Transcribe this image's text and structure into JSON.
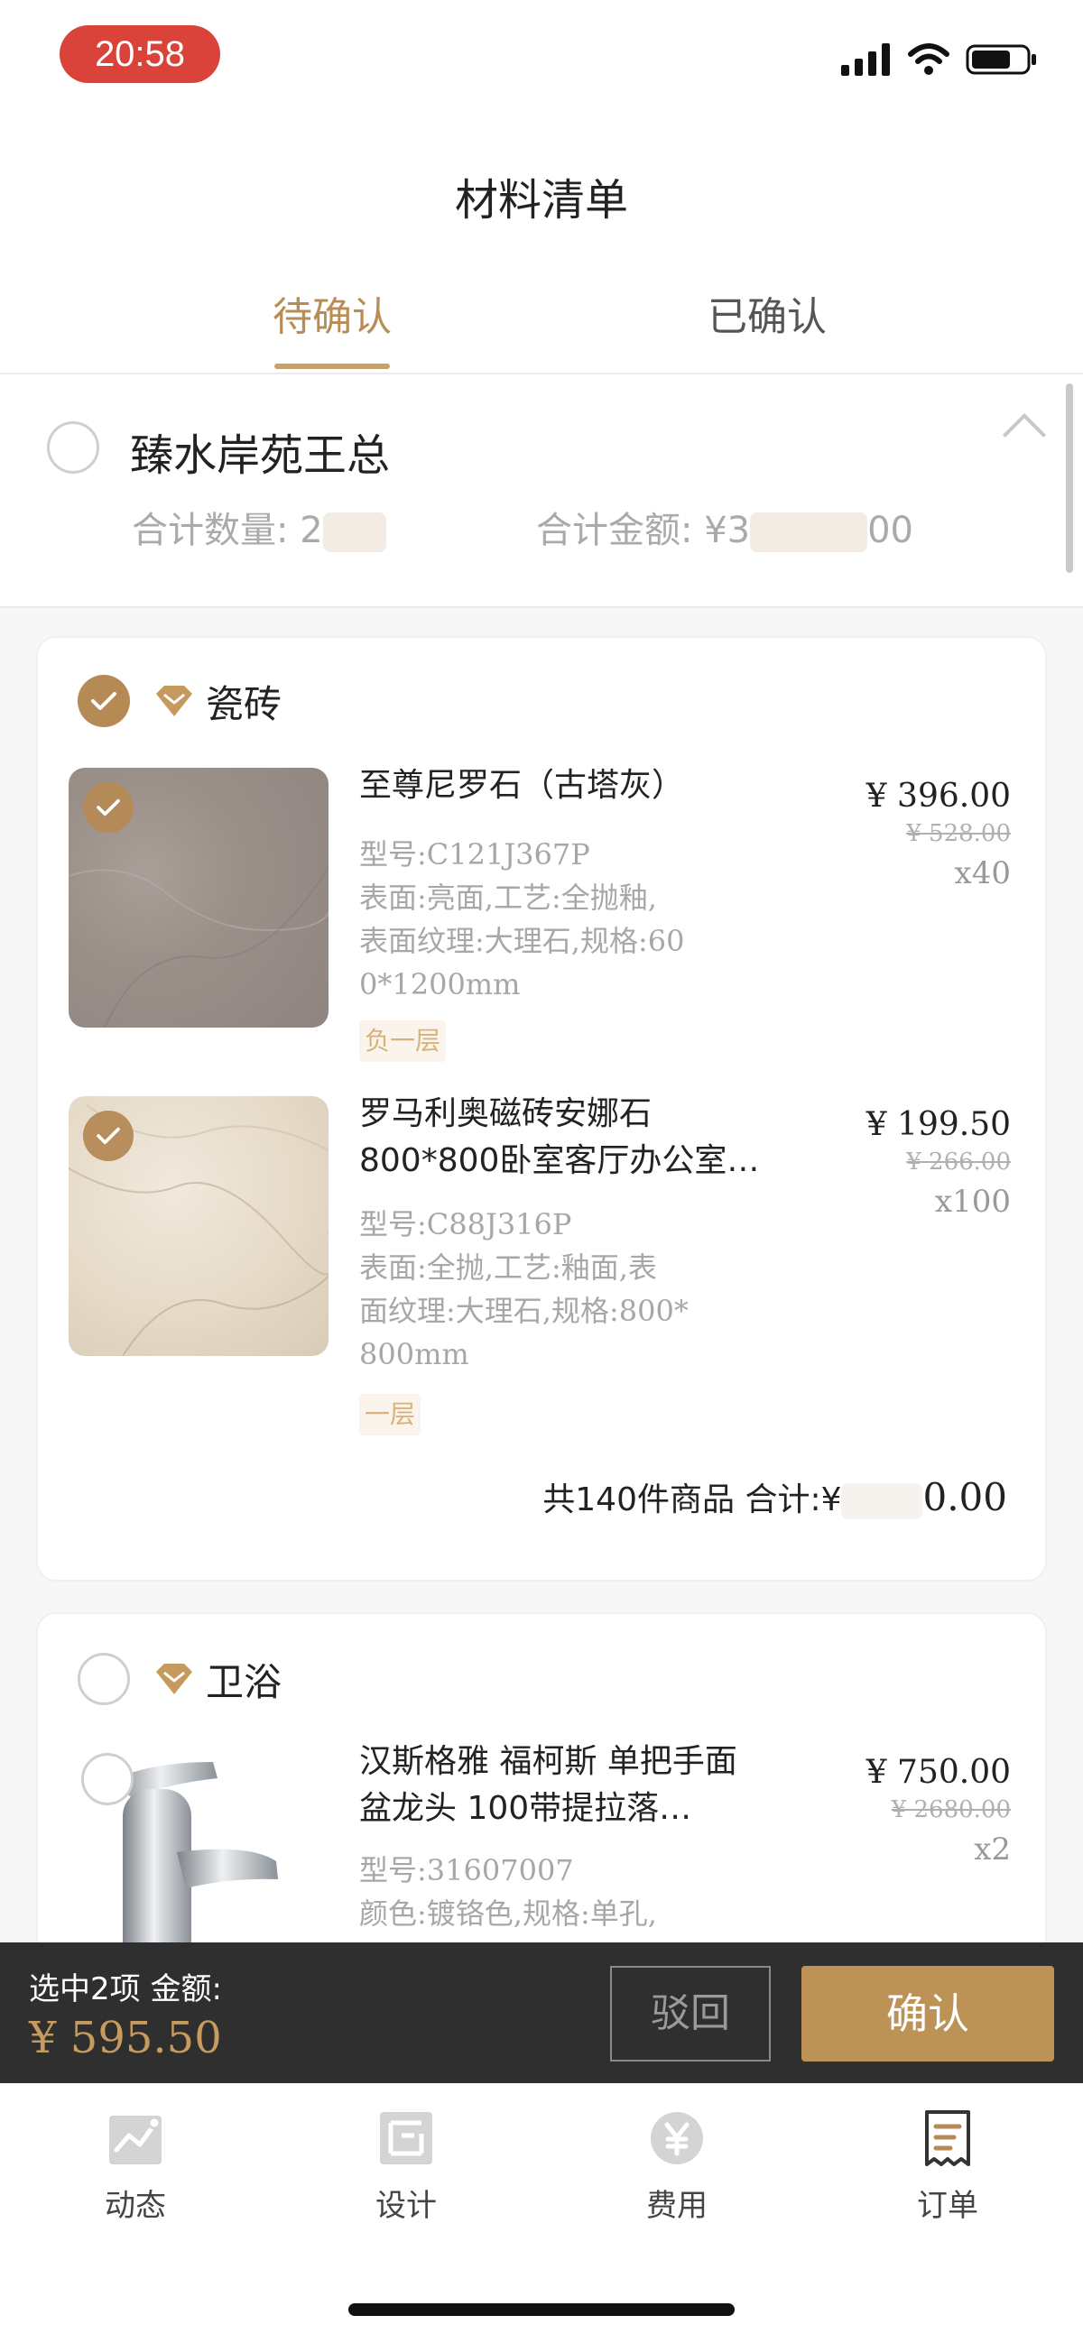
{
  "status_bar": {
    "time": "20:58"
  },
  "header": {
    "title": "材料清单"
  },
  "tabs": [
    {
      "label": "待确认",
      "active": true
    },
    {
      "label": "已确认",
      "active": false
    }
  ],
  "group": {
    "name": "臻水岸苑王总",
    "qty_label": "合计数量: 2",
    "amount_label": "合计金额: ¥3",
    "amount_tail": "00"
  },
  "cards": [
    {
      "category": "瓷砖",
      "checked": true,
      "items": [
        {
          "title": "至尊尼罗石（古塔灰）",
          "spec": [
            "型号:C121J367P",
            "表面:亮面,工艺:全抛釉,",
            "表面纹理:大理石,规格:60",
            "0*1200mm"
          ],
          "floor": "负一层",
          "price": "¥ 396.00",
          "old_price": "¥ 528.00",
          "qty": "x40",
          "checked": true
        },
        {
          "title": "罗马利奥磁砖安娜石800*800卧室客厅办公室…",
          "spec": [
            "型号:C88J316P",
            "表面:全抛,工艺:釉面,表",
            "面纹理:大理石,规格:800*",
            "800mm"
          ],
          "floor": "一层",
          "price": "¥ 199.50",
          "old_price": "¥ 266.00",
          "qty": "x100",
          "checked": true
        }
      ],
      "total_label": "共140件商品 合计:¥",
      "total_tail": "0.00"
    },
    {
      "category": "卫浴",
      "checked": false,
      "items": [
        {
          "title": "汉斯格雅 福柯斯 单把手面盆龙头 100带提拉落…",
          "spec": [
            "型号:31607007",
            "颜色:镀铬色,规格:单孔,"
          ],
          "price": "¥ 750.00",
          "old_price": "¥ 2680.00",
          "qty": "x2",
          "checked": false
        }
      ]
    }
  ],
  "action_bar": {
    "selected_label": "选中2项 金额:",
    "selected_amount": "¥ 595.50",
    "reject_label": "驳回",
    "confirm_label": "确认"
  },
  "tabbar": [
    {
      "label": "动态",
      "icon": "chart-icon"
    },
    {
      "label": "设计",
      "icon": "design-icon"
    },
    {
      "label": "费用",
      "icon": "yuan-coin-icon"
    },
    {
      "label": "订单",
      "icon": "receipt-icon"
    }
  ],
  "colors": {
    "accent": "#bd9257",
    "status_time_bg": "#d9433a",
    "action_bar_bg": "#2f2f2f"
  }
}
